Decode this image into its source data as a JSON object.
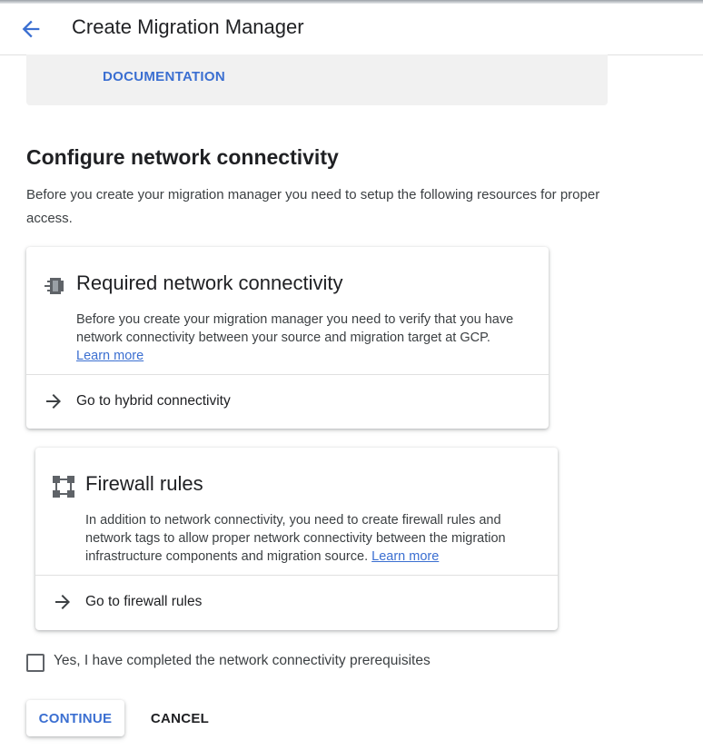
{
  "header": {
    "title": "Create Migration Manager",
    "back_icon": "arrow-back-icon"
  },
  "doc_panel": {
    "link_label": "DOCUMENTATION"
  },
  "section": {
    "title": "Configure network connectivity",
    "intro": "Before you create your migration manager you need to setup the following resources for proper access."
  },
  "cards": [
    {
      "icon": "network-device-icon",
      "title": "Required network connectivity",
      "body": "Before you create your migration manager you need to verify that you have network connectivity between your source and migration target at GCP.",
      "learn_more": "Learn more",
      "action_label": "Go to hybrid connectivity"
    },
    {
      "icon": "firewall-icon",
      "title": "Firewall rules",
      "body": "In addition to network connectivity, you need to create firewall rules and network tags to allow proper network connectivity between the migration infrastructure components and migration source.",
      "learn_more": "Learn more",
      "action_label": "Go to firewall rules"
    }
  ],
  "prereq_checkbox": {
    "label": "Yes, I have completed the network connectivity prerequisites",
    "checked": false
  },
  "buttons": {
    "continue_label": "CONTINUE",
    "cancel_label": "CANCEL"
  },
  "colors": {
    "accent": "#3b6fd1",
    "panel_bg": "#f1f1f1",
    "text": "#202124"
  }
}
